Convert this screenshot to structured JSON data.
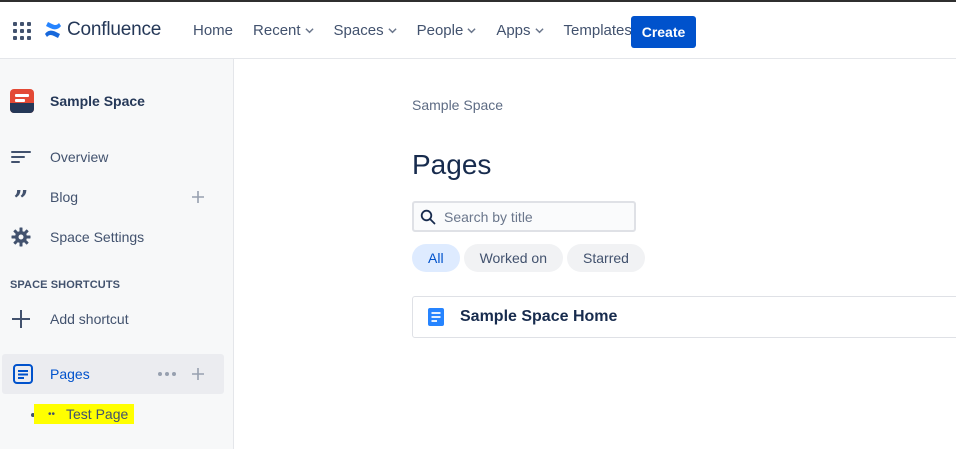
{
  "header": {
    "product": "Confluence",
    "nav": [
      {
        "label": "Home",
        "dropdown": false
      },
      {
        "label": "Recent",
        "dropdown": true
      },
      {
        "label": "Spaces",
        "dropdown": true
      },
      {
        "label": "People",
        "dropdown": true
      },
      {
        "label": "Apps",
        "dropdown": true
      },
      {
        "label": "Templates",
        "dropdown": false
      }
    ],
    "create_label": "Create"
  },
  "sidebar": {
    "space_name": "Sample Space",
    "items": [
      {
        "label": "Overview",
        "icon": "overview-icon"
      },
      {
        "label": "Blog",
        "icon": "quote-icon"
      },
      {
        "label": "Space Settings",
        "icon": "gear-icon"
      }
    ],
    "shortcuts_heading": "SPACE SHORTCUTS",
    "add_shortcut": "Add shortcut",
    "pages_label": "Pages",
    "child_page": {
      "label": "Test Page",
      "prefix": "••"
    }
  },
  "main": {
    "breadcrumb": "Sample Space",
    "title": "Pages",
    "search_placeholder": "Search by title",
    "filters": [
      "All",
      "Worked on",
      "Starred"
    ],
    "active_filter": "All",
    "pages": [
      {
        "title": "Sample Space Home"
      }
    ]
  },
  "colors": {
    "brand": "#0052CC",
    "highlight": "#FFFF00",
    "space_avatar": "#E34935"
  }
}
